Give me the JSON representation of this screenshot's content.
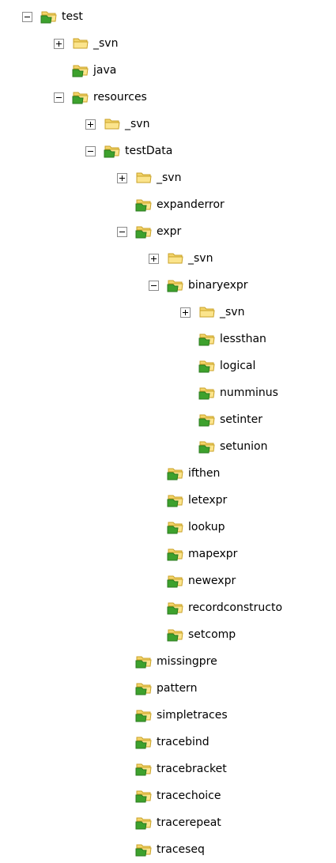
{
  "tree": {
    "nodes": [
      {
        "label": "test",
        "depth": 0,
        "toggle": "expanded",
        "icon": "versioned-folder-icon"
      },
      {
        "label": "_svn",
        "depth": 1,
        "toggle": "collapsed",
        "icon": "folder-icon"
      },
      {
        "label": "java",
        "depth": 1,
        "toggle": "none",
        "icon": "versioned-folder-icon"
      },
      {
        "label": "resources",
        "depth": 1,
        "toggle": "expanded",
        "icon": "versioned-folder-icon"
      },
      {
        "label": "_svn",
        "depth": 2,
        "toggle": "collapsed",
        "icon": "folder-icon"
      },
      {
        "label": "testData",
        "depth": 2,
        "toggle": "expanded",
        "icon": "versioned-folder-icon"
      },
      {
        "label": "_svn",
        "depth": 3,
        "toggle": "collapsed",
        "icon": "folder-icon"
      },
      {
        "label": "expanderror",
        "depth": 3,
        "toggle": "none",
        "icon": "versioned-folder-icon"
      },
      {
        "label": "expr",
        "depth": 3,
        "toggle": "expanded",
        "icon": "versioned-folder-icon"
      },
      {
        "label": "_svn",
        "depth": 4,
        "toggle": "collapsed",
        "icon": "folder-icon"
      },
      {
        "label": "binaryexpr",
        "depth": 4,
        "toggle": "expanded",
        "icon": "versioned-folder-icon"
      },
      {
        "label": "_svn",
        "depth": 5,
        "toggle": "collapsed",
        "icon": "folder-icon"
      },
      {
        "label": "lessthan",
        "depth": 5,
        "toggle": "none",
        "icon": "versioned-folder-icon"
      },
      {
        "label": "logical",
        "depth": 5,
        "toggle": "none",
        "icon": "versioned-folder-icon"
      },
      {
        "label": "numminus",
        "depth": 5,
        "toggle": "none",
        "icon": "versioned-folder-icon"
      },
      {
        "label": "setinter",
        "depth": 5,
        "toggle": "none",
        "icon": "versioned-folder-icon"
      },
      {
        "label": "setunion",
        "depth": 5,
        "toggle": "none",
        "icon": "versioned-folder-icon"
      },
      {
        "label": "ifthen",
        "depth": 4,
        "toggle": "none",
        "icon": "versioned-folder-icon"
      },
      {
        "label": "letexpr",
        "depth": 4,
        "toggle": "none",
        "icon": "versioned-folder-icon"
      },
      {
        "label": "lookup",
        "depth": 4,
        "toggle": "none",
        "icon": "versioned-folder-icon"
      },
      {
        "label": "mapexpr",
        "depth": 4,
        "toggle": "none",
        "icon": "versioned-folder-icon"
      },
      {
        "label": "newexpr",
        "depth": 4,
        "toggle": "none",
        "icon": "versioned-folder-icon"
      },
      {
        "label": "recordconstructo",
        "depth": 4,
        "toggle": "none",
        "icon": "versioned-folder-icon"
      },
      {
        "label": "setcomp",
        "depth": 4,
        "toggle": "none",
        "icon": "versioned-folder-icon"
      },
      {
        "label": "missingpre",
        "depth": 3,
        "toggle": "none",
        "icon": "versioned-folder-icon"
      },
      {
        "label": "pattern",
        "depth": 3,
        "toggle": "none",
        "icon": "versioned-folder-icon"
      },
      {
        "label": "simpletraces",
        "depth": 3,
        "toggle": "none",
        "icon": "versioned-folder-icon"
      },
      {
        "label": "tracebind",
        "depth": 3,
        "toggle": "none",
        "icon": "versioned-folder-icon"
      },
      {
        "label": "tracebracket",
        "depth": 3,
        "toggle": "none",
        "icon": "versioned-folder-icon"
      },
      {
        "label": "tracechoice",
        "depth": 3,
        "toggle": "none",
        "icon": "versioned-folder-icon"
      },
      {
        "label": "tracerepeat",
        "depth": 3,
        "toggle": "none",
        "icon": "versioned-folder-icon"
      },
      {
        "label": "traceseq",
        "depth": 3,
        "toggle": "none",
        "icon": "versioned-folder-icon"
      }
    ]
  },
  "colors": {
    "folder": "#f3d46a",
    "folder_dark": "#c9a227",
    "overlay_green": "#3da12d",
    "toggle_border": "#8c8c8c"
  }
}
